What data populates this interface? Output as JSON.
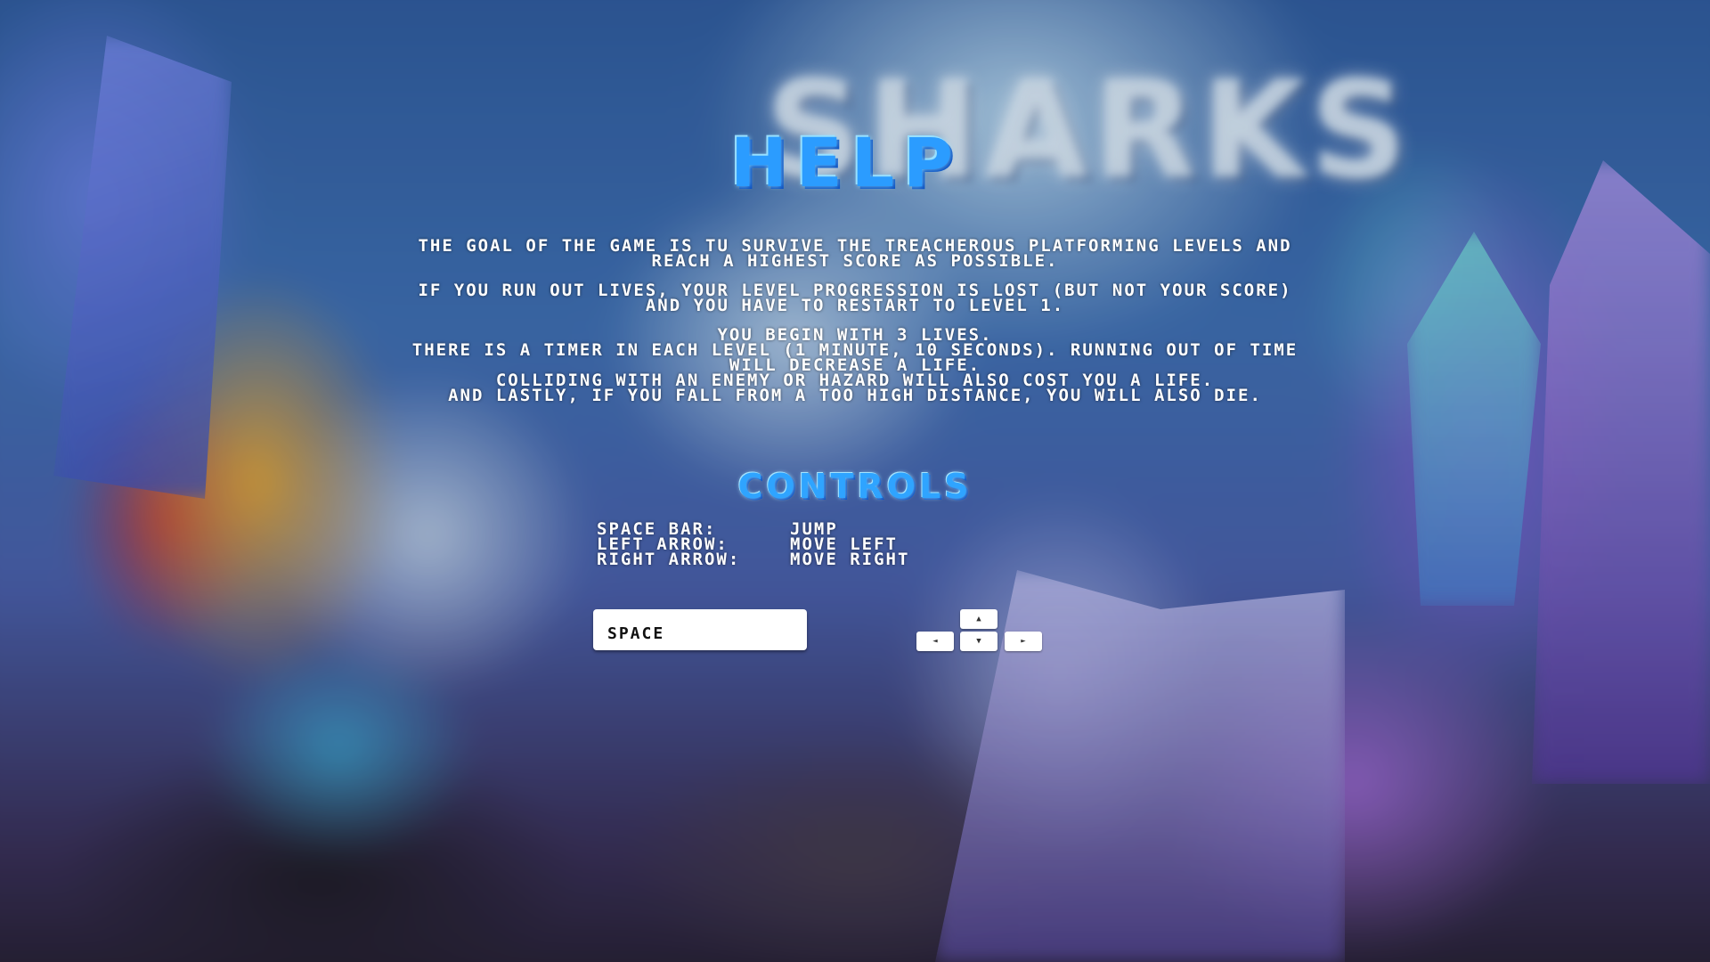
{
  "screen": {
    "title": "HELP",
    "background_logo": "SHARKS"
  },
  "help": {
    "paragraph1": "THE GOAL OF THE GAME IS TU SURVIVE THE TREACHEROUS PLATFORMING LEVELS AND REACH A HIGHEST SCORE AS POSSIBLE.",
    "paragraph2": "IF YOU RUN OUT LIVES, YOUR LEVEL PROGRESSION IS LOST (BUT NOT YOUR SCORE) AND YOU HAVE TO RESTART TO LEVEL 1.",
    "paragraph3_lines": [
      "YOU BEGIN WITH 3 LIVES.",
      "THERE IS A TIMER IN EACH LEVEL (1 MINUTE, 10 SECONDS). RUNNING OUT OF TIME WILL DECREASE A LIFE.",
      "COLLIDING WITH AN ENEMY OR HAZARD WILL ALSO COST YOU A LIFE.",
      "AND LASTLY, IF YOU FALL FROM A TOO HIGH DISTANCE, YOU WILL ALSO DIE."
    ]
  },
  "controls": {
    "heading": "CONTROLS",
    "rows": [
      {
        "key": "SPACE BAR:",
        "action": "JUMP"
      },
      {
        "key": "LEFT ARROW:",
        "action": "MOVE LEFT"
      },
      {
        "key": "RIGHT ARROW:",
        "action": "MOVE RIGHT"
      }
    ],
    "space_key_label": "SPACE",
    "arrow_glyphs": {
      "up": "▲",
      "down": "▼",
      "left": "◄",
      "right": "►"
    }
  },
  "colors": {
    "title_blue": "#2b9cff",
    "text": "#ffffff",
    "key_cap": "#ffffff"
  }
}
